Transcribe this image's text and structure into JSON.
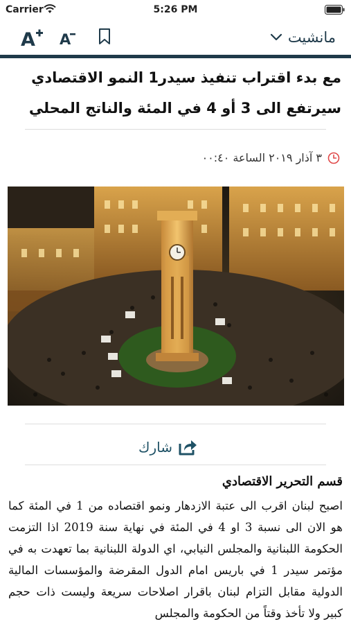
{
  "status_bar": {
    "carrier": "Carrier",
    "time": "5:26 PM"
  },
  "nav": {
    "section_title": "مانشيت",
    "icons": [
      "font-increase-icon",
      "font-decrease-icon",
      "bookmark-icon",
      "chevron-down-icon"
    ]
  },
  "article": {
    "headline": "مع بدء اقتراب تنفيذ سيدر1 النمو الاقتصادي سيرتفع الى 3 أو 4 في المئة والناتج المحلي",
    "date": "٣ آذار ٢٠١٩ الساعة ٠٠:٤٠",
    "share_label": "شارك",
    "byline": "قسم التحرير الاقتصادي",
    "body": "اصبح لبنان اقرب الى عتبة الازدهار ونمو اقتصاده من 1 في المئة كما هو الان الى نسبة 3 او 4 في المئة في نهاية سنة 2019 اذا التزمت الحكومة اللبنانية والمجلس النيابي، اي الدولة اللبنانية بما تعهدت به في مؤتمر سيدر 1 في باريس امام الدول المقرضة والمؤسسات المالية الدولية مقابل التزام لبنان باقرار اصلاحات سريعة وليست ذات حجم كبير ولا تأخذ وقتاً من الحكومة والمجلس"
  },
  "colors": {
    "brand": "#1f3a4a",
    "accent": "#1f5266",
    "clock": "#e04848"
  }
}
